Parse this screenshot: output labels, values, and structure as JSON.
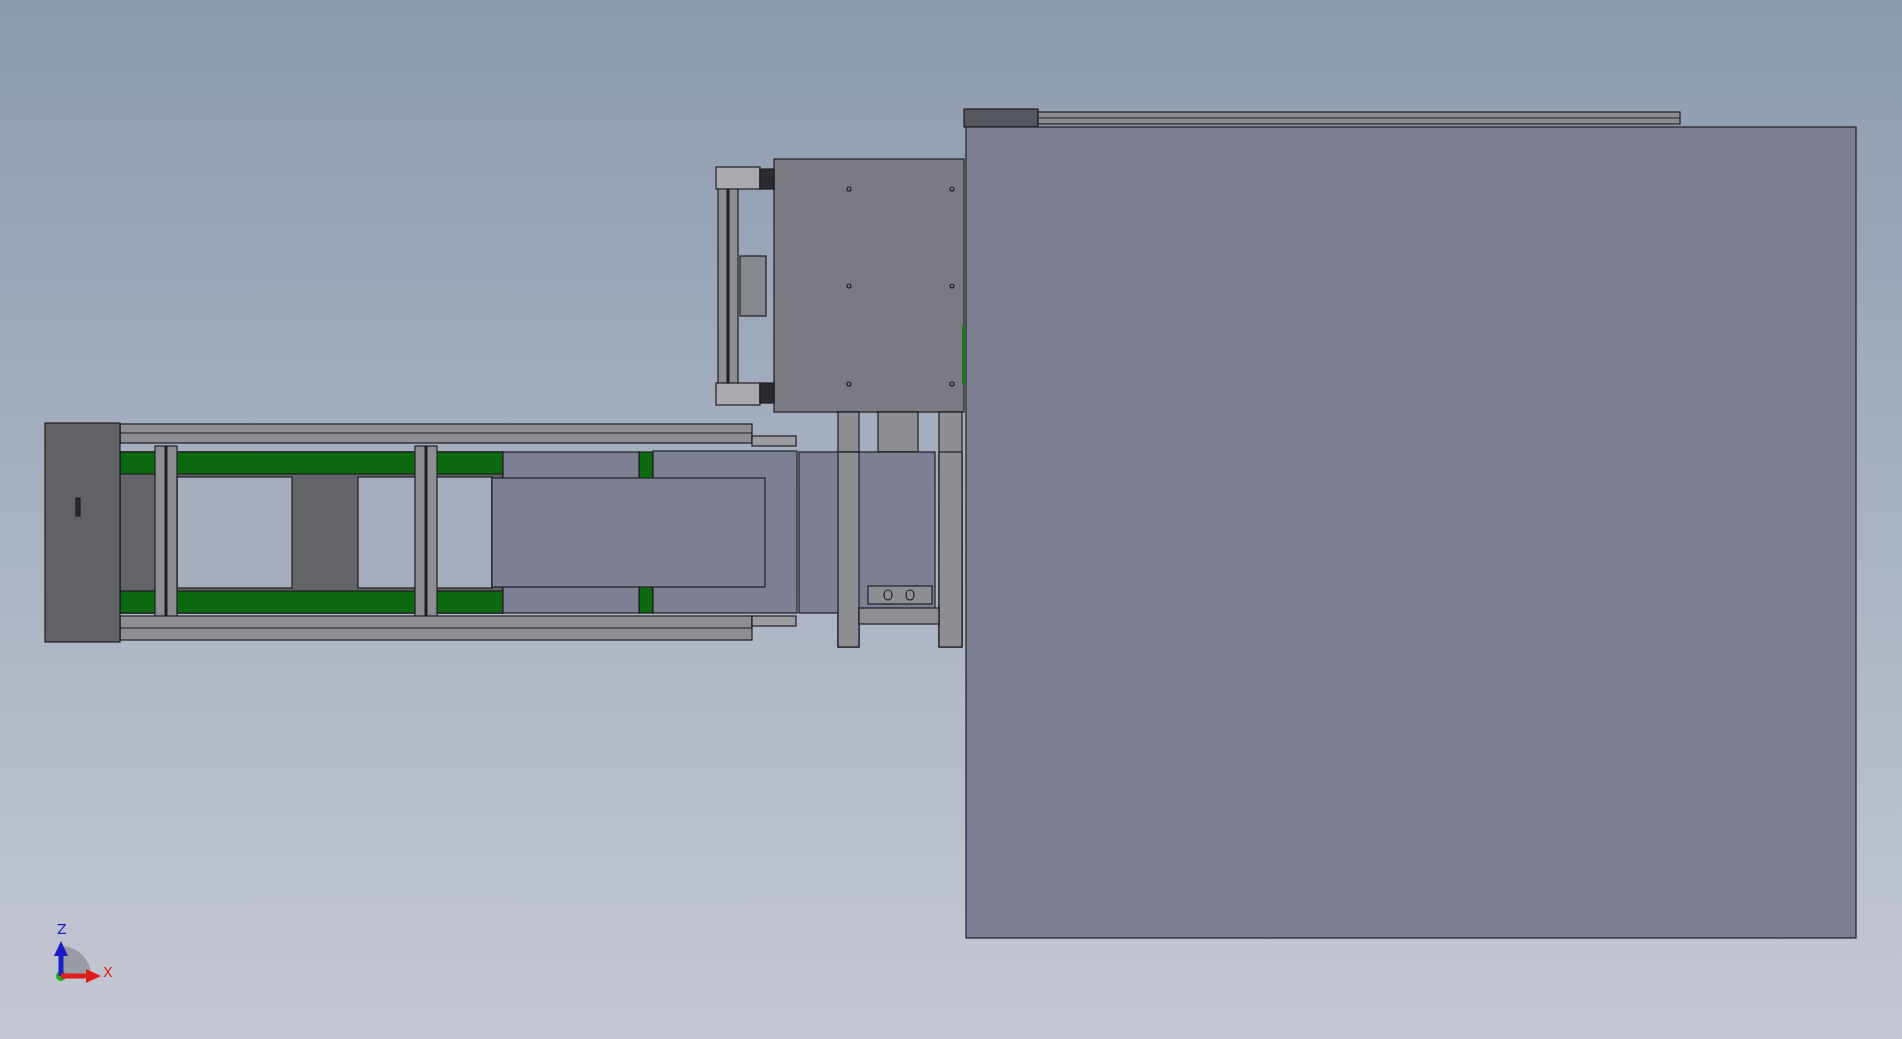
{
  "viewport": {
    "triad": {
      "axes": [
        {
          "kind": "vertical",
          "label": "Z",
          "color": "#1c1cc8"
        },
        {
          "kind": "horizontal",
          "label": "X",
          "color": "#e01c1c"
        }
      ]
    }
  }
}
